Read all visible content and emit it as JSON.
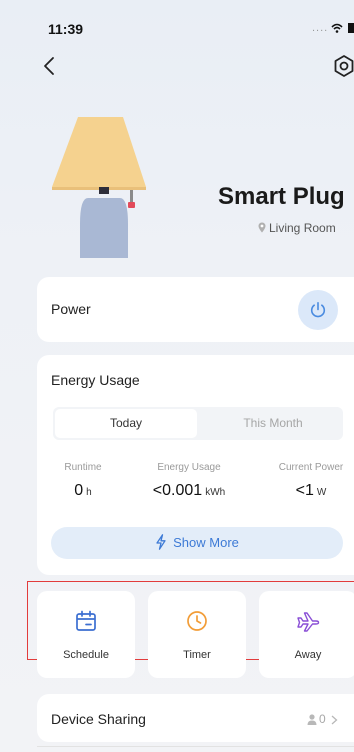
{
  "status_bar": {
    "time": "11:39",
    "signal_dots": "....",
    "icons": [
      "wifi-icon",
      "battery-icon"
    ]
  },
  "header": {
    "back_icon": "back-chevron-icon",
    "settings_icon": "gear-icon"
  },
  "device": {
    "name": "Smart Plug",
    "room": "Living Room",
    "image": "lamp-illustration"
  },
  "power": {
    "label": "Power",
    "icon": "power-icon"
  },
  "energy": {
    "title": "Energy Usage",
    "tabs": [
      "Today",
      "This Month"
    ],
    "active_tab": "Today",
    "stats": [
      {
        "label": "Runtime",
        "value": "0",
        "unit": "h"
      },
      {
        "label": "Energy Usage",
        "value": "<0.001",
        "unit": "kWh"
      },
      {
        "label": "Current Power",
        "value": "<1",
        "unit": "W"
      }
    ],
    "show_more_label": "Show More",
    "show_more_icon": "lightning-icon"
  },
  "quick_actions": [
    {
      "label": "Schedule",
      "icon": "calendar-icon"
    },
    {
      "label": "Timer",
      "icon": "clock-icon"
    },
    {
      "label": "Away",
      "icon": "airplane-icon"
    }
  ],
  "sharing": {
    "label": "Device Sharing",
    "count": "0",
    "icon": "person-icon"
  },
  "colors": {
    "accent": "#3d7ad6",
    "power_button_bg": "#dbe8f9",
    "schedule_icon": "#3c6fd1",
    "timer_icon": "#f29d38",
    "away_icon": "#8a4fd6",
    "highlight_box": "#e23c3c",
    "lamp_shade": "#f5d28f",
    "lamp_base": "#a9b8d4"
  }
}
